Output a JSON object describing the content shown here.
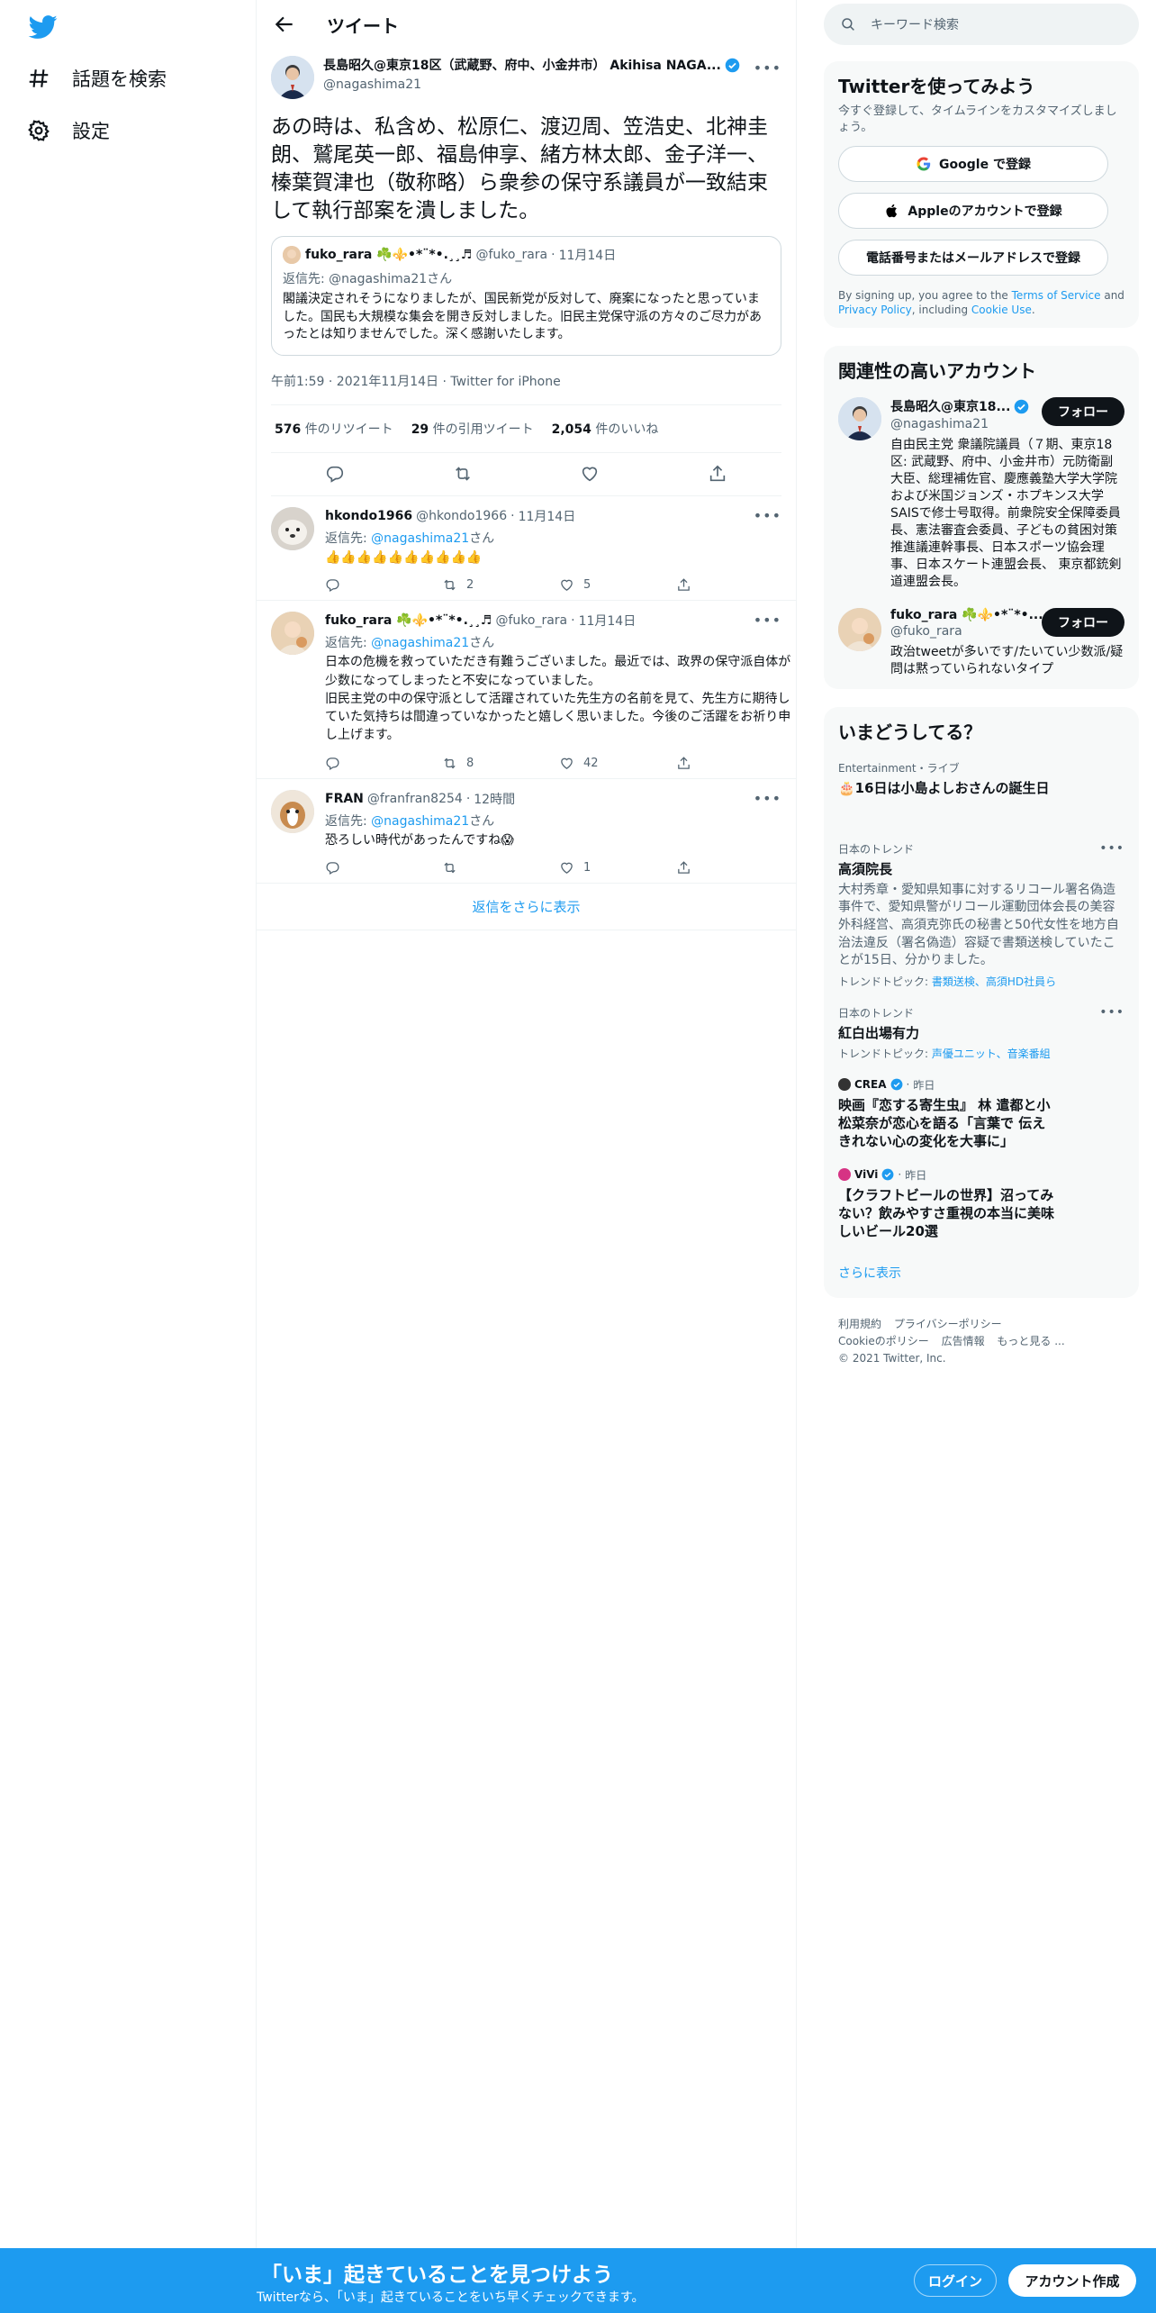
{
  "nav": {
    "items": [
      {
        "label": "話題を検索",
        "icon": "hashtag-icon"
      },
      {
        "label": "設定",
        "icon": "gear-icon"
      }
    ]
  },
  "main": {
    "title": "ツイート",
    "tweet": {
      "name": "長島昭久@東京18区（武蔵野、府中、小金井市） Akihisa NAGA...",
      "handle": "@nagashima21",
      "text": "あの時は、私含め、松原仁、渡辺周、笠浩史、北神圭朗、鷲尾英一郎、福島伸享、緒方林太郎、金子洋一、榛葉賀津也（敬称略）ら衆参の保守系議員が一致結束して執行部案を潰しました。",
      "quote": {
        "name": "fuko_rara ☘️⚜️•*¨*•.¸¸♬",
        "handle": "@fuko_rara",
        "date": "11月14日",
        "replyto": "返信先: @nagashima21さん",
        "text": "閣議決定されそうになりましたが、国民新党が反対して、廃案になったと思っていました。国民も大規模な集会を開き反対しました。旧民主党保守派の方々のご尽力があったとは知りませんでした。深く感謝いたします。"
      },
      "meta": "午前1:59 · 2021年11月14日 · Twitter for iPhone",
      "stats": {
        "retweets": "576",
        "retweets_label": "件のリツイート",
        "quotes": "29",
        "quotes_label": "件の引用ツイート",
        "likes": "2,054",
        "likes_label": "件のいいね"
      }
    },
    "replies": [
      {
        "name": "hkondo1966",
        "handle": "@hkondo1966",
        "date": "11月14日",
        "replyto_prefix": "返信先: ",
        "replyto_handle": "@nagashima21",
        "replyto_suffix": "さん",
        "text": "👍👍👍👍👍👍👍👍👍👍",
        "counts": {
          "reply": "",
          "retweet": "2",
          "like": "5"
        }
      },
      {
        "name": "fuko_rara ☘️⚜️•*¨*•.¸¸♬",
        "handle": "@fuko_rara",
        "date": "11月14日",
        "replyto_prefix": "返信先: ",
        "replyto_handle": "@nagashima21",
        "replyto_suffix": "さん",
        "text": "日本の危機を救っていただき有難うございました。最近では、政界の保守派自体が少数になってしまったと不安になっていました。\n旧民主党の中の保守派として活躍されていた先生方の名前を見て、先生方に期待していた気持ちは間違っていなかったと嬉しく思いました。今後のご活躍をお祈り申し上げます。",
        "counts": {
          "reply": "",
          "retweet": "8",
          "like": "42"
        }
      },
      {
        "name": "FRAN",
        "handle": "@franfran8254",
        "date": "12時間",
        "replyto_prefix": "返信先: ",
        "replyto_handle": "@nagashima21",
        "replyto_suffix": "さん",
        "text": "恐ろしい時代があったんですね😱",
        "counts": {
          "reply": "",
          "retweet": "",
          "like": "1"
        }
      }
    ],
    "show_more_replies": "返信をさらに表示"
  },
  "right": {
    "search_placeholder": "キーワード検索",
    "signup": {
      "title": "Twitterを使ってみよう",
      "sub": "今すぐ登録して、タイムラインをカスタマイズしましょう。",
      "google": "Google で登録",
      "apple": "Appleのアカウントで登録",
      "phone": "電話番号またはメールアドレスで登録",
      "terms_pre": "By signing up, you agree to the ",
      "terms_tos": "Terms of Service",
      "terms_and": " and ",
      "terms_privacy": "Privacy Policy",
      "terms_including": ", including ",
      "terms_cookie": "Cookie Use",
      "terms_end": "."
    },
    "related": {
      "title": "関連性の高いアカウント",
      "accounts": [
        {
          "name": "長島昭久@東京18...",
          "handle": "@nagashima21",
          "bio": "自由民主党 衆議院議員（７期、東京18区: 武蔵野、府中、小金井市）元防衛副大臣、総理補佐官、慶應義塾大学大学院および米国ジョンズ・ホプキンス大学SAISで修士号取得。前衆院安全保障委員長、憲法審査会委員、子どもの貧困対策推進議連幹事長、日本スポーツ協会理事、日本スケート連盟会長、 東京都銃剣道連盟会長。",
          "follow": "フォロー"
        },
        {
          "name": "fuko_rara ☘️⚜️•*¨*•...",
          "handle": "@fuko_rara",
          "bio": "政治tweetが多いです/たいてい少数派/疑問は黙っていられないタイプ",
          "follow": "フォロー"
        }
      ]
    },
    "trends": {
      "title": "いまどうしてる？",
      "items": [
        {
          "ctx": "Entertainment・ライブ",
          "title": "🎂16日は小島よしおさんの誕生日",
          "desc": "",
          "topics_label": "",
          "topics": ""
        },
        {
          "ctx": "日本のトレンド",
          "title": "高須院長",
          "desc": "大村秀章・愛知県知事に対するリコール署名偽造事件で、愛知県警がリコール運動団体会長の美容外科経営、高須克弥氏の秘書と50代女性を地方自治法違反（署名偽造）容疑で書類送検していたことが15日、分かりました。",
          "topics_label": "トレンドトピック: ",
          "topics": "書類送検、高須HD社員ら"
        },
        {
          "ctx": "日本のトレンド",
          "title": "紅白出場有力",
          "desc": "",
          "topics_label": "トレンドトピック: ",
          "topics": "声優ユニット、音楽番組"
        }
      ],
      "news": [
        {
          "src": "CREA",
          "date": "昨日",
          "title": "映画『恋する寄生虫』 林 遣都と小松菜奈が恋心を語る「言葉で 伝えきれない心の変化を大事に」"
        },
        {
          "src": "ViVi",
          "date": "昨日",
          "title": "【クラフトビールの世界】沼ってみない？飲みやすさ重視の本当に美味しいビール20選"
        }
      ],
      "show_more": "さらに表示"
    },
    "footer": {
      "links1": [
        "利用規約",
        "プライバシーポリシー"
      ],
      "links2": [
        "Cookieのポリシー",
        "広告情報",
        "もっと見る ..."
      ],
      "copyright": "© 2021 Twitter, Inc."
    }
  },
  "bottombar": {
    "title": "「いま」起きていることを見つけよう",
    "sub": "Twitterなら、「いま」起きていることをいち早くチェックできます。",
    "login": "ログイン",
    "signup": "アカウント作成"
  },
  "colors": {
    "accent": "#1d9bf0",
    "text": "#0f1419",
    "muted": "#536471"
  }
}
